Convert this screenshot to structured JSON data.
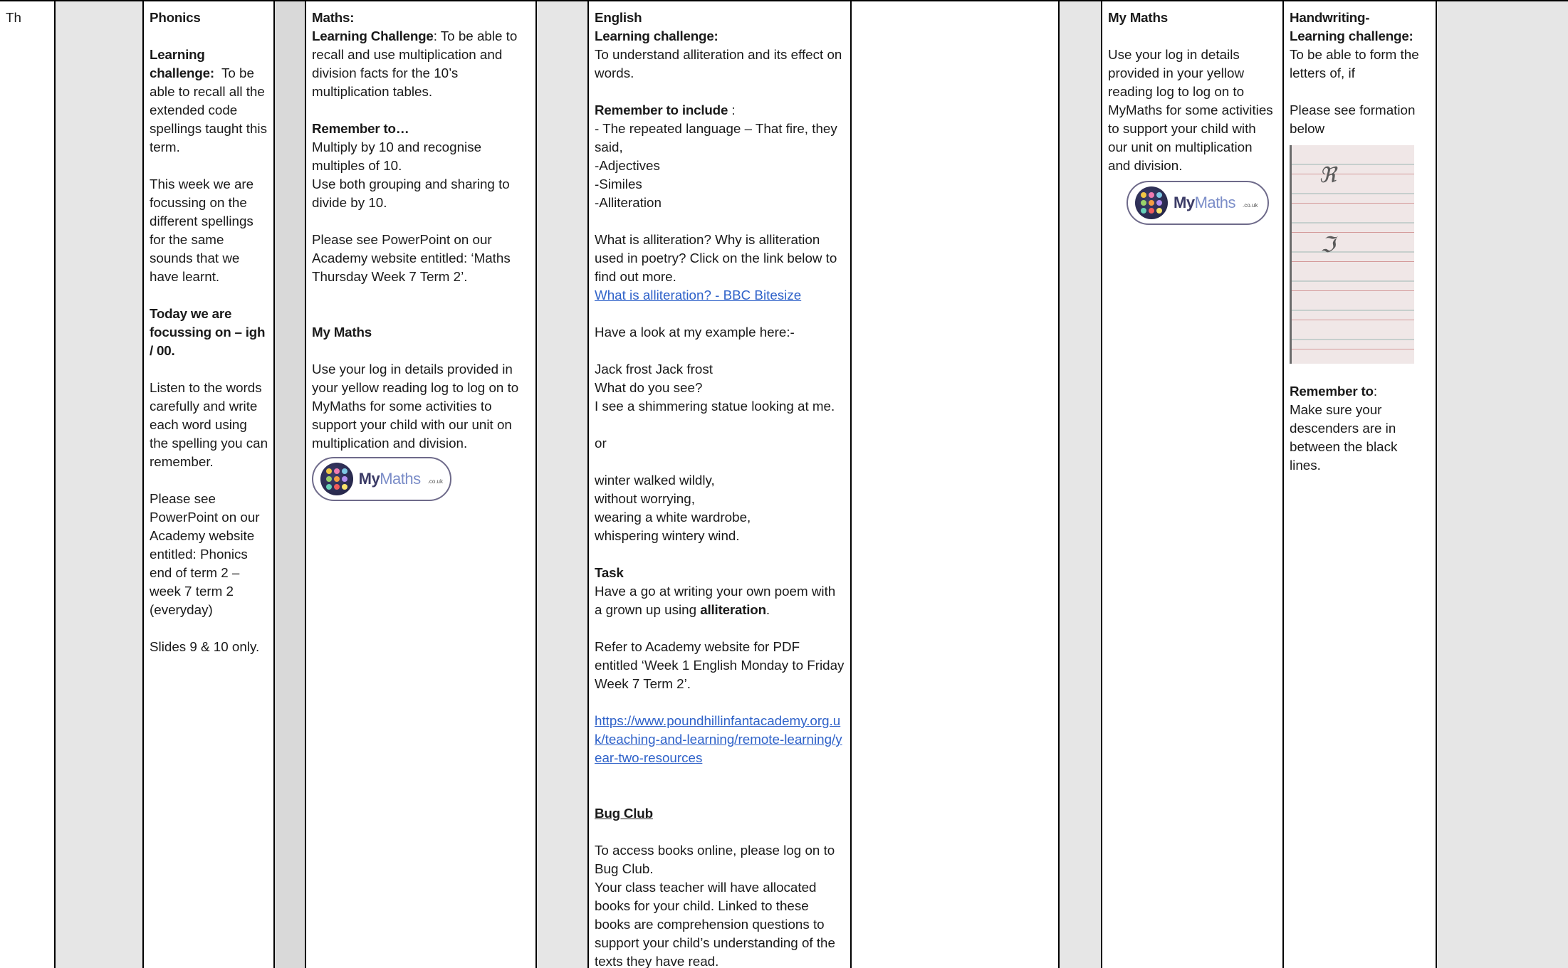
{
  "day": {
    "label": "Th"
  },
  "phonics": {
    "heading": "Phonics",
    "challenge_label": "Learning challenge:",
    "challenge_text": "To be able to recall all the extended code spellings taught this term.",
    "week_focus": "This week we are focussing on the different spellings for the same sounds that we have learnt.",
    "today_label": "Today we are focussing on – igh / 00.",
    "listen": "Listen to the words carefully and write each word using the spelling you can remember.",
    "see_powerpoint": "Please see PowerPoint on our Academy website entitled: Phonics end of term 2 – week 7 term 2 (everyday)",
    "slides": "Slides 9 & 10 only."
  },
  "maths": {
    "heading": "Maths:",
    "challenge_label": "Learning Challenge",
    "challenge_text": ":  To be able to recall and use multiplication and division facts for the 10’s multiplication tables.",
    "remember_label": "Remember to…",
    "remember_1": "Multiply by 10 and recognise multiples of 10.",
    "remember_2": "Use both grouping and sharing to divide by 10.",
    "see_powerpoint": "Please see PowerPoint on our Academy website entitled: ‘Maths Thursday Week 7 Term 2’.",
    "mymaths_heading": "My Maths",
    "mymaths_text": "Use your log in details provided in your yellow reading log to log on to MyMaths for some activities to support your child with our unit on multiplication and division.",
    "logo": {
      "word_1": "My",
      "word_2": "Maths",
      "tld": ".co.uk"
    }
  },
  "english": {
    "heading": "English",
    "challenge_label": "Learning challenge:",
    "challenge_text": "To understand alliteration and its effect on words.",
    "remember_label": "Remember to include",
    "remember_colon": " :",
    "items": [
      "- The repeated language – That fire, they said,",
      "-Adjectives",
      "-Similes",
      "-Alliteration"
    ],
    "question": "What is alliteration? Why is alliteration used in poetry? Click on the link below to find out more.",
    "bbc_link": "What is alliteration? - BBC Bitesize",
    "example_intro": " Have a look at my example here:-",
    "example_1": [
      "Jack frost Jack frost",
      "What do you see?",
      "I see a shimmering statue looking at me."
    ],
    "or": "or",
    "example_2": [
      " winter walked wildly,",
      "without worrying,",
      "wearing a white wardrobe,",
      "whispering wintery wind."
    ],
    "task_label": "Task",
    "task_text_1": "Have a go at writing your own poem with a grown up using ",
    "task_bold": "alliteration",
    "task_text_2": ".",
    "refer": "Refer to Academy website for PDF entitled ‘Week 1 English Monday to Friday Week 7 Term 2’.",
    "url": "https://www.poundhillinfantacademy.org.uk/teaching-and-learning/remote-learning/year-two-resources",
    "bugclub_heading": "Bug Club",
    "bugclub_1": "To access books online, please log on to Bug Club.",
    "bugclub_2": "Your class teacher will have allocated books for your child. Linked to these books are comprehension questions to support your child’s understanding of the texts they have read."
  },
  "mymaths": {
    "heading": "My Maths",
    "text": "Use your log in details provided in your yellow reading log to log on to MyMaths for some activities to support your child with our unit on multiplication and division.",
    "logo": {
      "word_1": "My",
      "word_2": "Maths",
      "tld": ".co.uk"
    }
  },
  "handwriting": {
    "heading": "Handwriting-",
    "challenge_label": "Learning challenge:",
    "challenge_text": "To be able to form the letters of, if",
    "formation": "Please see formation below",
    "remember_label": "Remember to",
    "remember_colon": ":",
    "remember_text": "Make sure your descenders are in between the black lines."
  },
  "logo_colors": [
    "#f2c744",
    "#f07ab0",
    "#7ec8e3",
    "#9ad26a",
    "#f59e42",
    "#b38df0",
    "#66d1b8",
    "#f25c5c",
    "#f7e36b"
  ]
}
